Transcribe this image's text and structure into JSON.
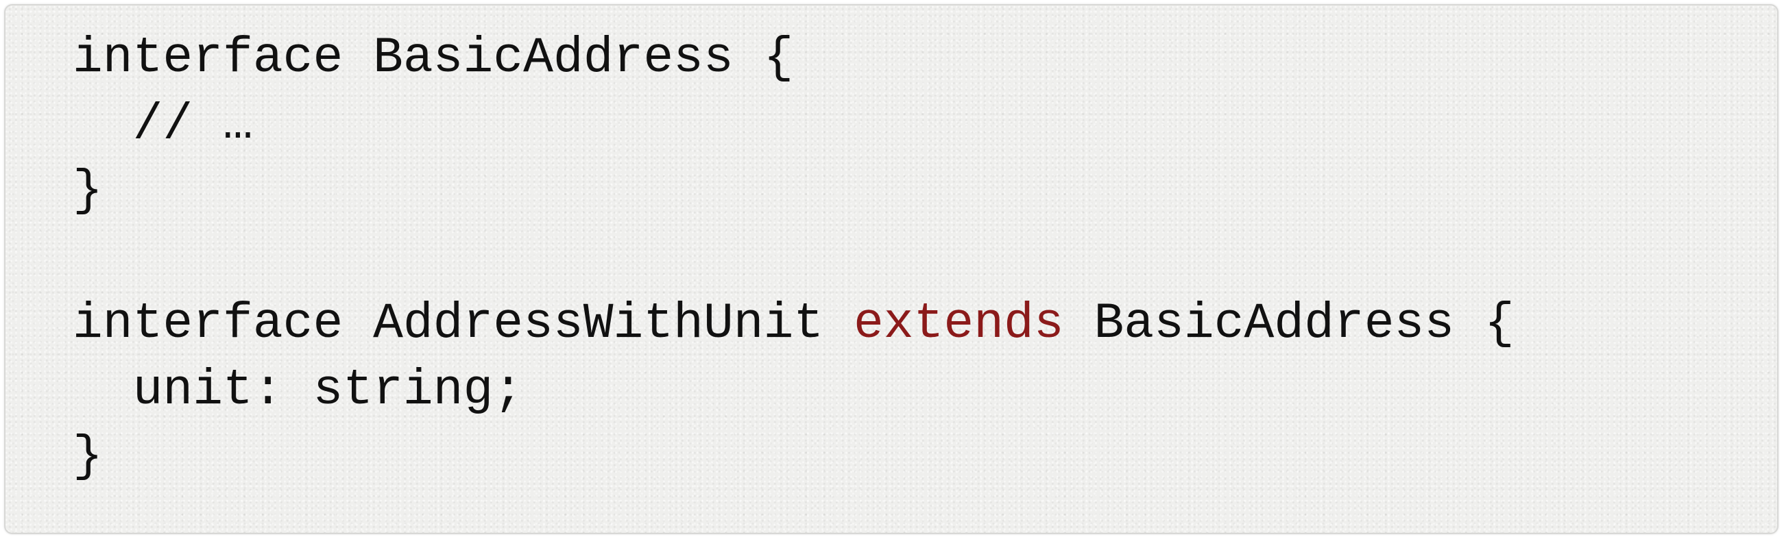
{
  "code": {
    "line1": "interface BasicAddress {",
    "line2": "  // …",
    "line3": "}",
    "line4": "",
    "line5_prefix": "interface AddressWithUnit ",
    "line5_keyword": "extends",
    "line5_suffix": " BasicAddress {",
    "line6": "  unit: string;",
    "line7": "}"
  },
  "colors": {
    "text": "#111111",
    "keyword": "#8b1a1a",
    "background": "#efefed"
  }
}
